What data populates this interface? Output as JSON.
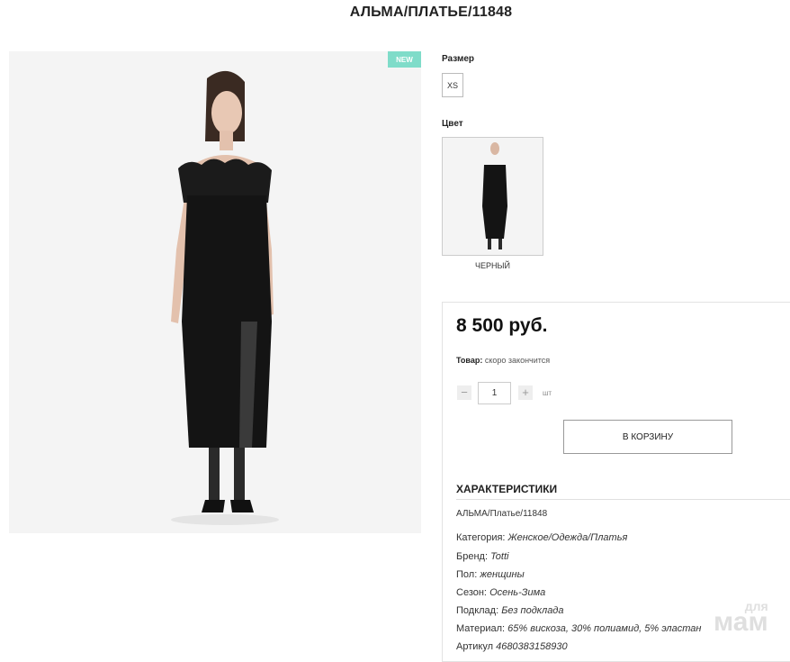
{
  "product": {
    "title": "АЛЬМА/ПЛАТЬЕ/11848",
    "badge": "NEW"
  },
  "size": {
    "label": "Размер",
    "options": [
      "XS"
    ]
  },
  "color": {
    "label": "Цвет",
    "name": "ЧЕРНЫЙ"
  },
  "purchase": {
    "price": "8 500 руб.",
    "stock_label": "Товар:",
    "stock_value": "скоро закончится",
    "quantity": "1",
    "minus": "−",
    "plus": "+",
    "unit": "шт",
    "cart_button": "В КОРЗИНУ"
  },
  "specs": {
    "title": "ХАРАКТЕРИСТИКИ",
    "sku": "АЛЬМА/Платье/11848",
    "rows": [
      {
        "label": "Категория:",
        "value": "Женское/Одежда/Платья"
      },
      {
        "label": "Бренд:",
        "value": "Totti"
      },
      {
        "label": "Пол:",
        "value": "женщины"
      },
      {
        "label": "Сезон:",
        "value": "Осень-Зима"
      },
      {
        "label": "Подклад:",
        "value": "Без подклада"
      },
      {
        "label": "Материал:",
        "value": "65% вискоза, 30% полиамид, 5% эластан"
      },
      {
        "label": "Артикул",
        "value": "4680383158930"
      }
    ]
  },
  "watermark": {
    "top": "для",
    "bottom": "мам"
  },
  "colors": {
    "badge": "#7fdcc9",
    "dress": "#141414",
    "background": "#f4f4f4"
  }
}
